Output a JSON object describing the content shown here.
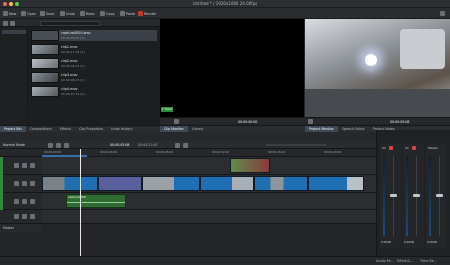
{
  "window": {
    "title": "Untitled * / 1920x1080 24.00fps"
  },
  "toolbar": {
    "new": "New",
    "open": "Open",
    "save": "Save",
    "undo": "Undo",
    "redo": "Redo",
    "copy": "Copy",
    "paste": "Paste",
    "render": "Render"
  },
  "bin": {
    "clips": [
      {
        "name": "capture0000.wav",
        "time": "00:00:03:22 [1]"
      },
      {
        "name": "clip1.mov",
        "time": "00:00:17:09 [1]"
      },
      {
        "name": "clip2.mov",
        "time": "00:00:04:03 [1]"
      },
      {
        "name": "clip3.mov",
        "time": "00:00:08:23 [1]"
      },
      {
        "name": "clip4.mov",
        "time": "00:00:07:19 [1]"
      }
    ]
  },
  "clip_monitor": {
    "timecode": "00:00:00:00",
    "badge": "1 Track"
  },
  "project_monitor": {
    "timecode": "00:00:05:08"
  },
  "tabs_left": [
    "Project Bin",
    "Compositions",
    "Effects",
    "Clip Properties",
    "Undo History"
  ],
  "tabs_mid": [
    "Clip Monitor",
    "Library"
  ],
  "tabs_right": [
    "Project Monitor",
    "Speech Editor",
    "Project Notes"
  ],
  "timeline": {
    "mode": "Normal Mode",
    "timecode_a": "00:00:05:08",
    "timecode_b": "00:00:21:00",
    "ruler": [
      "00:00:00:00",
      "00:00:04:00",
      "00:00:08:00",
      "00:00:12:00",
      "00:00:16:00",
      "00:00:20:00"
    ],
    "master": "Master",
    "audio_clip": "capture0000"
  },
  "mixer": {
    "channels": [
      "A2",
      "A1",
      "Master"
    ],
    "levels": [
      "0.00dB",
      "0.00dB",
      "0.00dB"
    ]
  },
  "status": {
    "tabs": [
      "Audio Mi...",
      "Effect/C...",
      "Time Re..."
    ]
  },
  "colors": {
    "accent": "#3a6ea8",
    "video_clip": "#1f6fb2",
    "audio_clip": "#2f8a3b",
    "selected_clip": "#5a5f9e",
    "record": "#d64545"
  }
}
